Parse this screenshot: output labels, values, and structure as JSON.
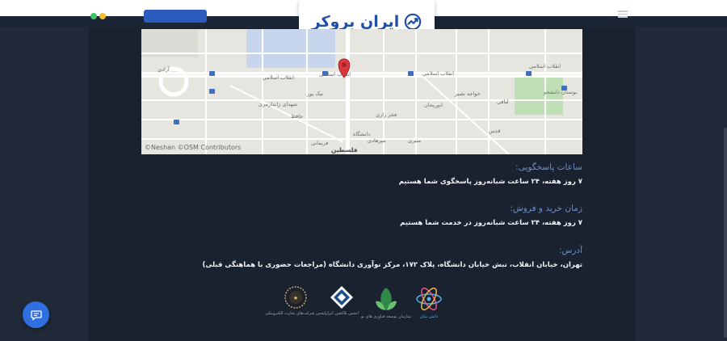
{
  "brand": {
    "name": "ایران بروکر",
    "primary": "#1f4fa8",
    "accent": "#2f6fe0"
  },
  "map": {
    "credit": "©Neshan ©OSM Contributors",
    "streets": {
      "main": "انقلاب اسلامی",
      "main_left": "انقلاب اسلامی",
      "main_right": "انقلاب اسلامی",
      "park": "بوستان دانشجو",
      "bottom": "فلسطین",
      "s1": "شهدای ژاندارمری",
      "s2": "خواجه نصیر",
      "s3": "حافظ",
      "s4": "آزادی",
      "s5": "فخر رازی",
      "s6": "ابوریحان",
      "s7": "دانشگاه",
      "s8": "لبافی",
      "s9": "نیک پور",
      "s10": "قدس",
      "s11": "فریمانی",
      "s12": "میرهادی",
      "s13": "منیری"
    }
  },
  "info": {
    "support_label": "ساعات پاسخگویی:",
    "support_value": "۷ روز هفته، ۲۴ ساعت شبانه‌روز پاسخگوی شما هستیم",
    "trade_label": "زمان خرید و فروش:",
    "trade_value": "۷ روز هفته، ۲۴ ساعت شبانه‌روز در خدمت شما هستیم",
    "address_label": "آدرس:",
    "address_value": "تهران، خیابان انقلاب، نبش خیابان دانشگاه، پلاک ۱۷۲، مرکز نوآوری دانشگاه (مراجعات حضوری با هماهنگی قبلی)"
  },
  "badges": [
    {
      "name": "nano",
      "caption": "دانش بنیان"
    },
    {
      "name": "innovation",
      "caption": "سازمان توسعه فناوری های نو"
    },
    {
      "name": "blockchain",
      "caption": "انجمن بلاکچین ایران"
    },
    {
      "name": "ecommerce",
      "caption": "انجمن شرکت‌های تجارت الکترونیکی"
    }
  ],
  "icons": {
    "chat": "chat-bubble-icon",
    "menu": "hamburger-icon",
    "marker": "map-marker-icon"
  }
}
